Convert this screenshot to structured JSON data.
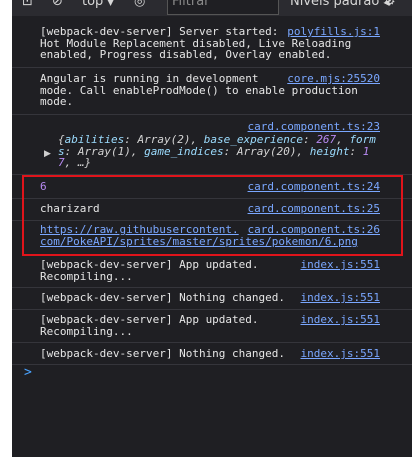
{
  "toolbar": {
    "level_select_label": "top",
    "level_caret": "▼",
    "filter_placeholder": "Filtrar",
    "default_levels_label": "Níveis padrão",
    "levels_caret": "◀"
  },
  "messages": [
    {
      "text": "[webpack-dev-server] Server started:\nHot Module Replacement disabled, Live Reloading\nenabled, Progress disabled, Overlay enabled.",
      "source": "polyfills.js:1"
    },
    {
      "text": "Angular is running in development\nmode. Call enableProdMode() to enable production\nmode.",
      "source": "core.mjs:25520"
    },
    {
      "source": "card.component.ts:23",
      "object_preview": {
        "open": "{",
        "k1": "abilities",
        "v1": "Array(2)",
        "k2": "base_experience",
        "v2": "267",
        "k3": "form",
        "k4": "s",
        "v4": "Array(1)",
        "k5": "game_indices",
        "v5": "Array(20)",
        "k6": "height",
        "v6": "1",
        "k7": "7",
        "ellipsis": "…}"
      }
    },
    {
      "value": "6",
      "source": "card.component.ts:24"
    },
    {
      "text": "charizard",
      "source": "card.component.ts:25"
    },
    {
      "url_line1": "https://raw.githubusercontent.",
      "url_line2": "com/PokeAPI/sprites/master/sprites/pokemon/6.png",
      "source": "card.component.ts:26"
    },
    {
      "text": "[webpack-dev-server] App updated.\nRecompiling...",
      "source": "index.js:551"
    },
    {
      "text": "[webpack-dev-server] Nothing changed.",
      "source": "index.js:551"
    },
    {
      "text": "[webpack-dev-server] App updated.\nRecompiling...",
      "source": "index.js:551"
    },
    {
      "text": "[webpack-dev-server] Nothing changed.",
      "source": "index.js:551"
    }
  ],
  "prompt_symbol": ">",
  "colors": {
    "background": "#1f1f23",
    "link": "#7aa7ff",
    "highlight": "#e0141b",
    "number": "#b78af2"
  }
}
